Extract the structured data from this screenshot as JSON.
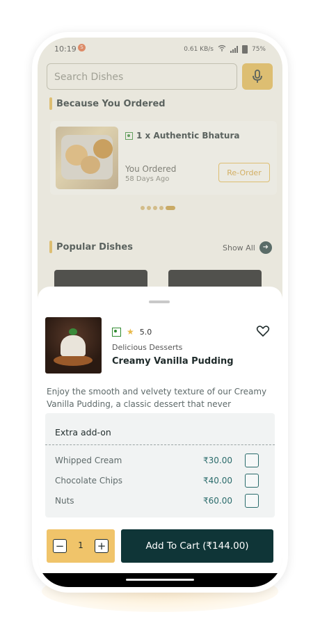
{
  "status": {
    "time": "10:19",
    "notif_badge": "S",
    "net_speed": "0.61 KB/s",
    "battery": "75%"
  },
  "search": {
    "placeholder": "Search Dishes"
  },
  "because_you_ordered": {
    "title": "Because You Ordered",
    "item": "1 x Authentic Bhatura",
    "you_ordered": "You Ordered",
    "days_ago": "58 Days Ago",
    "reorder_label": "Re-Order"
  },
  "popular": {
    "title": "Popular Dishes",
    "show_all": "Show All"
  },
  "sheet": {
    "rating": "5.0",
    "category": "Delicious Desserts",
    "name": "Creamy Vanilla Pudding",
    "description": "Enjoy the smooth and velvety texture of our Creamy Vanilla Pudding, a classic dessert that never",
    "addons": {
      "title": "Extra add-on",
      "items": [
        {
          "name": "Whipped Cream",
          "price": "₹30.00"
        },
        {
          "name": "Chocolate Chips",
          "price": "₹40.00"
        },
        {
          "name": "Nuts",
          "price": "₹60.00"
        }
      ]
    },
    "quantity": "1",
    "minus": "−",
    "plus": "+",
    "add_to_cart": "Add To Cart (₹144.00)"
  },
  "colors": {
    "accent": "#e8b94a",
    "primary": "#0f3537",
    "veg": "#2f8a2f"
  }
}
